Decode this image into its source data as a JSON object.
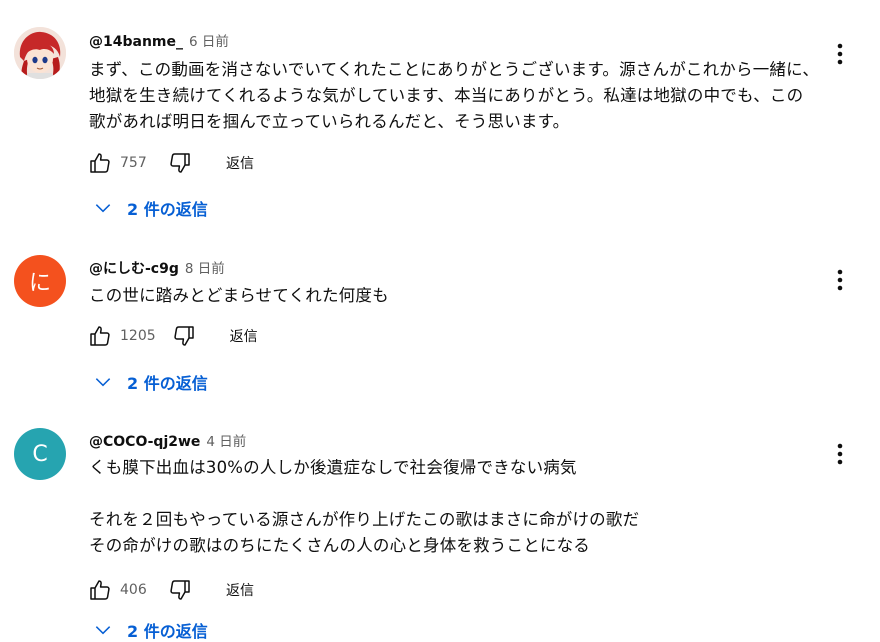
{
  "comments": [
    {
      "author": "@14banme_",
      "time": "6 日前",
      "text": "まず、この動画を消さないでいてくれたことにありがとうございます。源さんがこれから一緒に、地獄を生き続けてくれるような気がしています、本当にありがとう。私達は地獄の中でも、この歌があれば明日を掴んで立っていられるんだと、そう思います。",
      "likes": "757",
      "reply_label": "返信",
      "replies_label": "2 件の返信"
    },
    {
      "author": "@にしむ-c9g",
      "time": "8 日前",
      "avatar_letter": "に",
      "avatar_color": "#f4511e",
      "text": "この世に踏みとどまらせてくれた何度も",
      "likes": "1205",
      "reply_label": "返信",
      "replies_label": "2 件の返信"
    },
    {
      "author": "@COCO-qj2we",
      "time": "4 日前",
      "avatar_letter": "C",
      "avatar_color": "#26a4b0",
      "text": "くも膜下出血は30%の人しか後遺症なしで社会復帰できない病気\n\nそれを２回もやっている源さんが作り上げたこの歌はまさに命がけの歌だ\nその命がけの歌はのちにたくさんの人の心と身体を救うことになる",
      "likes": "406",
      "reply_label": "返信",
      "replies_label": "2 件の返信"
    }
  ],
  "colors": {
    "link_blue": "#065fd4",
    "secondary_text": "#606060",
    "primary_text": "#0f0f0f"
  },
  "icons": [
    "thumb-up-icon",
    "thumb-down-icon",
    "chevron-down-icon",
    "more-vert-icon"
  ]
}
